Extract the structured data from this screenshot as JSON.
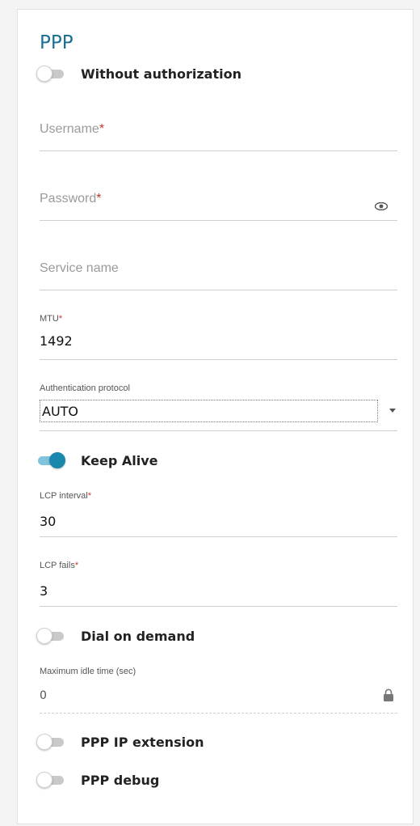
{
  "section": {
    "title": "PPP"
  },
  "toggles": {
    "without_authorization": {
      "label": "Without authorization",
      "on": false
    },
    "keep_alive": {
      "label": "Keep Alive",
      "on": true
    },
    "dial_on_demand": {
      "label": "Dial on demand",
      "on": false
    },
    "ppp_ip_extension": {
      "label": "PPP IP extension",
      "on": false
    },
    "ppp_debug": {
      "label": "PPP debug",
      "on": false
    }
  },
  "fields": {
    "username": {
      "placeholder": "Username",
      "required_mark": "*"
    },
    "password": {
      "placeholder": "Password",
      "required_mark": "*",
      "icon": "eye-icon"
    },
    "service_name": {
      "placeholder": "Service name"
    },
    "mtu": {
      "label": "MTU",
      "required_mark": "*",
      "value": "1492"
    },
    "auth_protocol": {
      "label": "Authentication protocol",
      "value": "AUTO"
    },
    "lcp_interval": {
      "label": "LCP interval",
      "required_mark": "*",
      "value": "30"
    },
    "lcp_fails": {
      "label": "LCP fails",
      "required_mark": "*",
      "value": "3"
    },
    "max_idle_time": {
      "label": "Maximum idle time (sec)",
      "value": "0",
      "icon": "lock-icon"
    }
  },
  "colors": {
    "accent": "#1a87ad",
    "title": "#1a6f93",
    "required": "#c0392b"
  }
}
